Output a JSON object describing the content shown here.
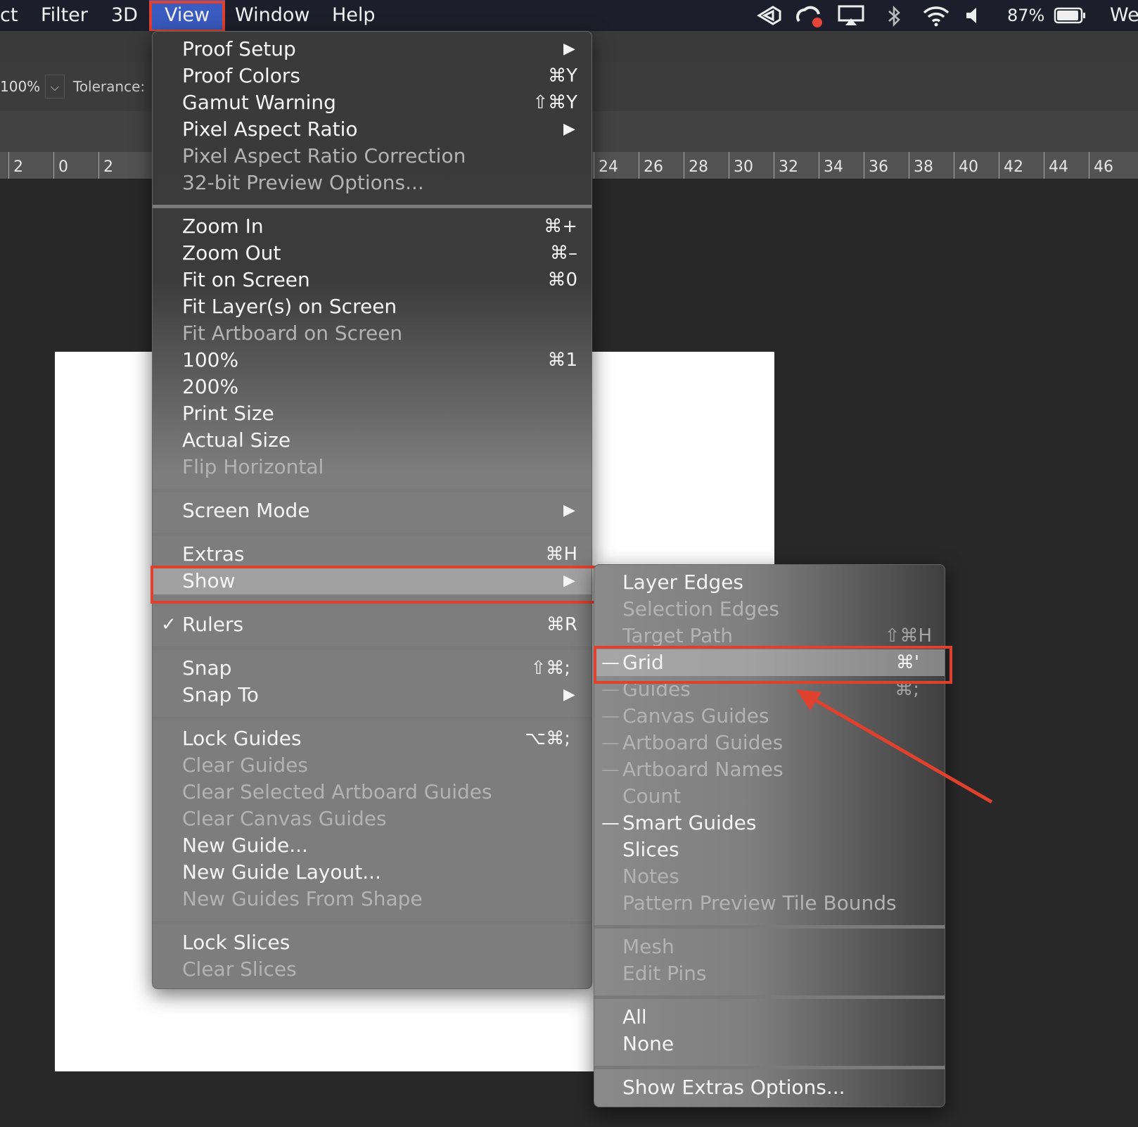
{
  "menubar": {
    "items": [
      "ct",
      "Filter",
      "3D",
      "View",
      "Window",
      "Help"
    ],
    "battery": "87%",
    "clock": "We"
  },
  "options": {
    "zoom_value": "100%",
    "tolerance_label": "Tolerance:"
  },
  "ruler": {
    "left_ticks": [
      "2",
      "0",
      "2"
    ],
    "right_ticks": [
      "24",
      "26",
      "28",
      "30",
      "32",
      "34",
      "36",
      "38",
      "40",
      "42",
      "44",
      "46"
    ]
  },
  "view_menu": {
    "items": [
      {
        "label": "Proof Setup",
        "shortcut": "",
        "submenu": true,
        "enabled": true
      },
      {
        "label": "Proof Colors",
        "shortcut": "⌘Y",
        "submenu": false,
        "enabled": true
      },
      {
        "label": "Gamut Warning",
        "shortcut": "⇧⌘Y",
        "submenu": false,
        "enabled": true
      },
      {
        "label": "Pixel Aspect Ratio",
        "shortcut": "",
        "submenu": true,
        "enabled": true
      },
      {
        "label": "Pixel Aspect Ratio Correction",
        "shortcut": "",
        "submenu": false,
        "enabled": false
      },
      {
        "label": "32-bit Preview Options...",
        "shortcut": "",
        "submenu": false,
        "enabled": false
      },
      {
        "label": "Zoom In",
        "shortcut": "⌘+",
        "submenu": false,
        "enabled": true
      },
      {
        "label": "Zoom Out",
        "shortcut": "⌘–",
        "submenu": false,
        "enabled": true
      },
      {
        "label": "Fit on Screen",
        "shortcut": "⌘0",
        "submenu": false,
        "enabled": true
      },
      {
        "label": "Fit Layer(s) on Screen",
        "shortcut": "",
        "submenu": false,
        "enabled": true
      },
      {
        "label": "Fit Artboard on Screen",
        "shortcut": "",
        "submenu": false,
        "enabled": false
      },
      {
        "label": "100%",
        "shortcut": "⌘1",
        "submenu": false,
        "enabled": true
      },
      {
        "label": "200%",
        "shortcut": "",
        "submenu": false,
        "enabled": true
      },
      {
        "label": "Print Size",
        "shortcut": "",
        "submenu": false,
        "enabled": true
      },
      {
        "label": "Actual Size",
        "shortcut": "",
        "submenu": false,
        "enabled": true
      },
      {
        "label": "Flip Horizontal",
        "shortcut": "",
        "submenu": false,
        "enabled": false
      },
      {
        "label": "Screen Mode",
        "shortcut": "",
        "submenu": true,
        "enabled": true
      },
      {
        "label": "Extras",
        "shortcut": "⌘H",
        "submenu": false,
        "enabled": true
      },
      {
        "label": "Show",
        "shortcut": "",
        "submenu": true,
        "enabled": true,
        "highlighted": true
      },
      {
        "label": "Rulers",
        "shortcut": "⌘R",
        "submenu": false,
        "enabled": true,
        "checked": true
      },
      {
        "label": "Snap",
        "shortcut": "⇧⌘;",
        "submenu": false,
        "enabled": true
      },
      {
        "label": "Snap To",
        "shortcut": "",
        "submenu": true,
        "enabled": true
      },
      {
        "label": "Lock Guides",
        "shortcut": "⌥⌘;",
        "submenu": false,
        "enabled": true
      },
      {
        "label": "Clear Guides",
        "shortcut": "",
        "submenu": false,
        "enabled": false
      },
      {
        "label": "Clear Selected Artboard Guides",
        "shortcut": "",
        "submenu": false,
        "enabled": false
      },
      {
        "label": "Clear Canvas Guides",
        "shortcut": "",
        "submenu": false,
        "enabled": false
      },
      {
        "label": "New Guide...",
        "shortcut": "",
        "submenu": false,
        "enabled": true
      },
      {
        "label": "New Guide Layout...",
        "shortcut": "",
        "submenu": false,
        "enabled": true
      },
      {
        "label": "New Guides From Shape",
        "shortcut": "",
        "submenu": false,
        "enabled": false
      },
      {
        "label": "Lock Slices",
        "shortcut": "",
        "submenu": false,
        "enabled": true
      },
      {
        "label": "Clear Slices",
        "shortcut": "",
        "submenu": false,
        "enabled": false
      }
    ],
    "check_mark": "✓",
    "submenu_arrow": "▶"
  },
  "show_menu": {
    "items": [
      {
        "label": "Layer Edges",
        "shortcut": "",
        "enabled": true,
        "dash": false
      },
      {
        "label": "Selection Edges",
        "shortcut": "",
        "enabled": false,
        "dash": false
      },
      {
        "label": "Target Path",
        "shortcut": "⇧⌘H",
        "enabled": false,
        "dash": false
      },
      {
        "label": "Grid",
        "shortcut": "⌘'",
        "enabled": true,
        "dash": true,
        "highlighted": true
      },
      {
        "label": "Guides",
        "shortcut": "⌘;",
        "enabled": false,
        "dash": true
      },
      {
        "label": "Canvas Guides",
        "shortcut": "",
        "enabled": false,
        "dash": true
      },
      {
        "label": "Artboard Guides",
        "shortcut": "",
        "enabled": false,
        "dash": true
      },
      {
        "label": "Artboard Names",
        "shortcut": "",
        "enabled": false,
        "dash": true
      },
      {
        "label": "Count",
        "shortcut": "",
        "enabled": false,
        "dash": false
      },
      {
        "label": "Smart Guides",
        "shortcut": "",
        "enabled": true,
        "dash": true
      },
      {
        "label": "Slices",
        "shortcut": "",
        "enabled": true,
        "dash": false
      },
      {
        "label": "Notes",
        "shortcut": "",
        "enabled": false,
        "dash": false
      },
      {
        "label": "Pattern Preview Tile Bounds",
        "shortcut": "",
        "enabled": false,
        "dash": false
      },
      {
        "label": "Mesh",
        "shortcut": "",
        "enabled": false,
        "dash": false
      },
      {
        "label": "Edit Pins",
        "shortcut": "",
        "enabled": false,
        "dash": false
      },
      {
        "label": "All",
        "shortcut": "",
        "enabled": true,
        "dash": false
      },
      {
        "label": "None",
        "shortcut": "",
        "enabled": true,
        "dash": false
      },
      {
        "label": "Show Extras Options...",
        "shortcut": "",
        "enabled": true,
        "dash": false
      }
    ],
    "dash_glyph": "—"
  },
  "annotation": {
    "box_color": "#e0402e",
    "arrow_color": "#e0402e"
  }
}
